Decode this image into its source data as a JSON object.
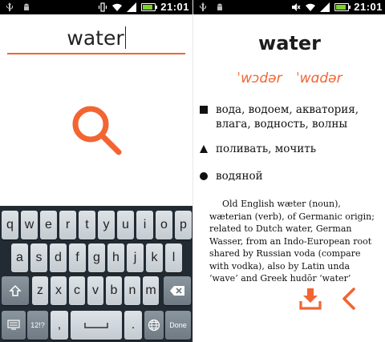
{
  "status_bar": {
    "time": "21:01",
    "left_icons": [
      "usb-icon",
      "android-icon"
    ],
    "right_icons": [
      "vibrate-icon",
      "wifi-icon",
      "signal-icon",
      "battery-icon"
    ],
    "battery_level": 0.7
  },
  "search": {
    "value": "water"
  },
  "keyboard": {
    "row1": [
      "q",
      "w",
      "e",
      "r",
      "t",
      "y",
      "u",
      "i",
      "o",
      "p"
    ],
    "row2": [
      "a",
      "s",
      "d",
      "f",
      "g",
      "h",
      "j",
      "k",
      "l"
    ],
    "row3": [
      "z",
      "x",
      "c",
      "v",
      "b",
      "n",
      "m"
    ],
    "num_label": "12!?",
    "comma": ",",
    "period": ".",
    "done_label": "Done"
  },
  "entry": {
    "word": "water",
    "pronunciation": "ˈwɔdər ˈwɑdər",
    "definitions": [
      {
        "marker": "square",
        "text": "вода, водоем, акватория, влага, водность, волны"
      },
      {
        "marker": "triangle",
        "text": "поливать, мочить"
      },
      {
        "marker": "circle",
        "text": "водяной"
      }
    ],
    "etymology": "Old English wæter (noun), wæterian (verb), of Germanic origin; related to Dutch water, German Wasser, from an Indo-European root shared by Russian voda (compare with vodka), also by Latin unda ‘wave’ and Greek hudōr ‘water’"
  },
  "colors": {
    "accent": "#f26532",
    "keyboard_bg": "#222a33",
    "status_bar_bg": "#000000"
  }
}
